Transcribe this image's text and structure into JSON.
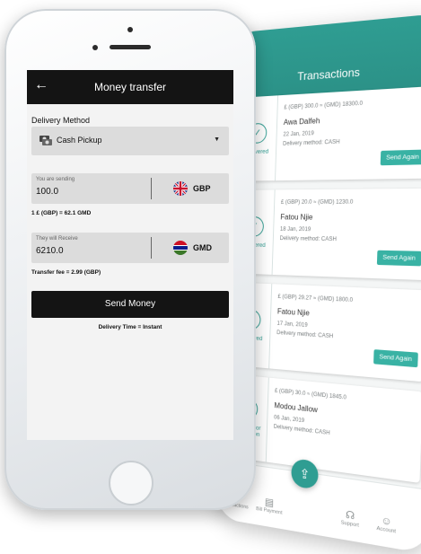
{
  "transactions": {
    "title": "Transactions",
    "items": [
      {
        "status": "Delivered",
        "amount": "£ (GBP) 300.0 ≈ (GMD) 18300.0",
        "name": "Awa Dalfeh",
        "date": "22 Jan, 2019",
        "method": "Delivery method: CASH",
        "action": "Send Again"
      },
      {
        "status": "Delivered",
        "amount": "£ (GBP) 20.0 ≈ (GMD) 1230.0",
        "name": "Fatou Njie",
        "date": "18 Jan, 2019",
        "method": "Delivery method: CASH",
        "action": "Send Again"
      },
      {
        "status": "Delivered",
        "amount": "£ (GBP) 29.27 ≈ (GMD) 1800.0",
        "name": "Fatou Njie",
        "date": "17 Jan, 2019",
        "method": "Delivery method: CASH",
        "action": "Send Again"
      },
      {
        "status": "Ready For Collection",
        "amount": "£ (GBP) 30.0 ≈ (GMD) 1845.0",
        "name": "Modou Jallow",
        "date": "06 Jan, 2019",
        "method": "Delivery method: CASH",
        "action": ""
      }
    ],
    "nav": [
      "Transactions",
      "Bill Payment",
      "",
      "Support",
      "Account"
    ]
  },
  "screen": {
    "title": "Money transfer",
    "delivery_label": "Delivery Method",
    "delivery_value": "Cash Pickup",
    "send_hint": "You are sending",
    "send_value": "100.0",
    "send_currency": "GBP",
    "rate": "1 £ (GBP) = 62.1 GMD",
    "receive_hint": "They will Receive",
    "receive_value": "6210.0",
    "receive_currency": "GMD",
    "fee": "Transfer fee = 2.99 (GBP)",
    "send_button": "Send Money",
    "delivery_time": "Delivery Time = Instant"
  },
  "colors": {
    "accent": "#2f9d92",
    "dark": "#141414"
  }
}
